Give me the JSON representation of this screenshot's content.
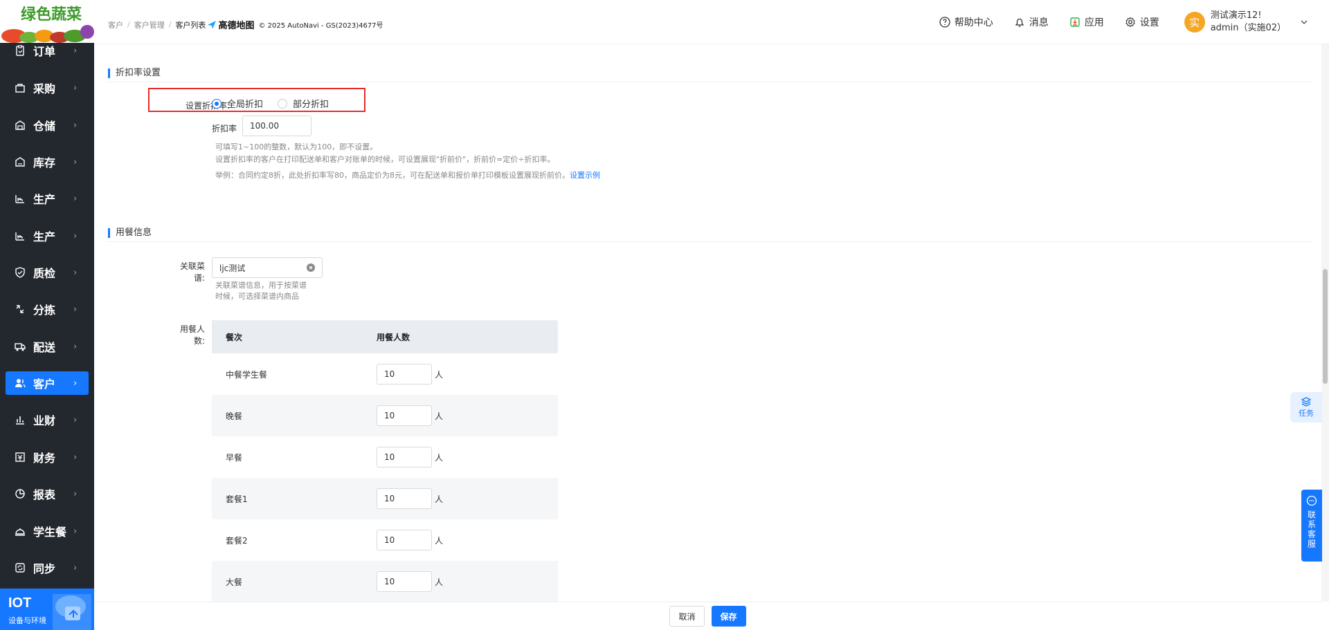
{
  "brand": {
    "logo_text": "绿色蔬菜"
  },
  "sidebar": {
    "items": [
      {
        "label": "订单",
        "icon": "clipboard-icon"
      },
      {
        "label": "采购",
        "icon": "shopping-bag-icon"
      },
      {
        "label": "仓储",
        "icon": "warehouse-icon"
      },
      {
        "label": "库存",
        "icon": "inventory-icon"
      },
      {
        "label": "生产",
        "icon": "factory-icon"
      },
      {
        "label": "生产",
        "icon": "factory-icon"
      },
      {
        "label": "质检",
        "icon": "shield-check-icon"
      },
      {
        "label": "分拣",
        "icon": "sorting-icon"
      },
      {
        "label": "配送",
        "icon": "truck-icon"
      },
      {
        "label": "客户",
        "icon": "users-icon"
      },
      {
        "label": "业财",
        "icon": "bar-chart-icon"
      },
      {
        "label": "财务",
        "icon": "finance-icon"
      },
      {
        "label": "报表",
        "icon": "pie-chart-icon"
      },
      {
        "label": "学生餐",
        "icon": "cloche-icon"
      },
      {
        "label": "同步",
        "icon": "sync-icon"
      }
    ],
    "active_index": 9,
    "iot": {
      "title": "IOT",
      "subtitle": "设备与环境"
    }
  },
  "header": {
    "breadcrumbs": [
      "客户",
      "客户管理",
      "客户列表"
    ],
    "map_brand": "高德地图",
    "map_copyright": "© 2025 AutoNavi - GS(2023)4677号",
    "help": "帮助中心",
    "messages": "消息",
    "apps": "应用",
    "settings": "设置",
    "user": {
      "avatar_char": "实",
      "name": "测试演示12!",
      "account": "admin（实施02）"
    }
  },
  "discount": {
    "section_title": "折扣率设置",
    "mode_label": "设置折扣率:",
    "options": [
      "全局折扣",
      "部分折扣"
    ],
    "selected": "全局折扣",
    "rate_label": "折扣率",
    "rate_value": "100.00",
    "hint1": "可填写1~100的整数，默认为100，即不设置。",
    "hint2": "设置折扣率的客户在打印配送单和客户对账单的时候，可设置展现\"折前价\"，折前价=定价÷折扣率。",
    "hint3": "举例：合同约定8折，此处折扣率写80，商品定价为8元，可在配送单和报价单打印模板设置展现折前价。",
    "hint3_link": "设置示例"
  },
  "meal": {
    "section_title": "用餐信息",
    "menu_label": "关联菜谱:",
    "menu_value": "ljc测试",
    "menu_hint1": "关联菜谱信息，用于按菜谱",
    "menu_hint2": "时候，可选择菜谱内商品",
    "people_label": "用餐人数:",
    "columns": [
      "餐次",
      "用餐人数"
    ],
    "unit": "人",
    "rows": [
      {
        "name": "中餐学生餐",
        "count": "10"
      },
      {
        "name": "晚餐",
        "count": "10"
      },
      {
        "name": "早餐",
        "count": "10"
      },
      {
        "name": "套餐1",
        "count": "10"
      },
      {
        "name": "套餐2",
        "count": "10"
      },
      {
        "name": "大餐",
        "count": "10"
      }
    ]
  },
  "float": {
    "task": "任务",
    "customer_service": "联系客服"
  },
  "footer": {
    "cancel": "取消",
    "save": "保存"
  },
  "colors": {
    "primary": "#1677ff",
    "sidebar_bg": "#23272e",
    "highlight_box": "#e52a2a",
    "avatar": "#f5a623"
  }
}
